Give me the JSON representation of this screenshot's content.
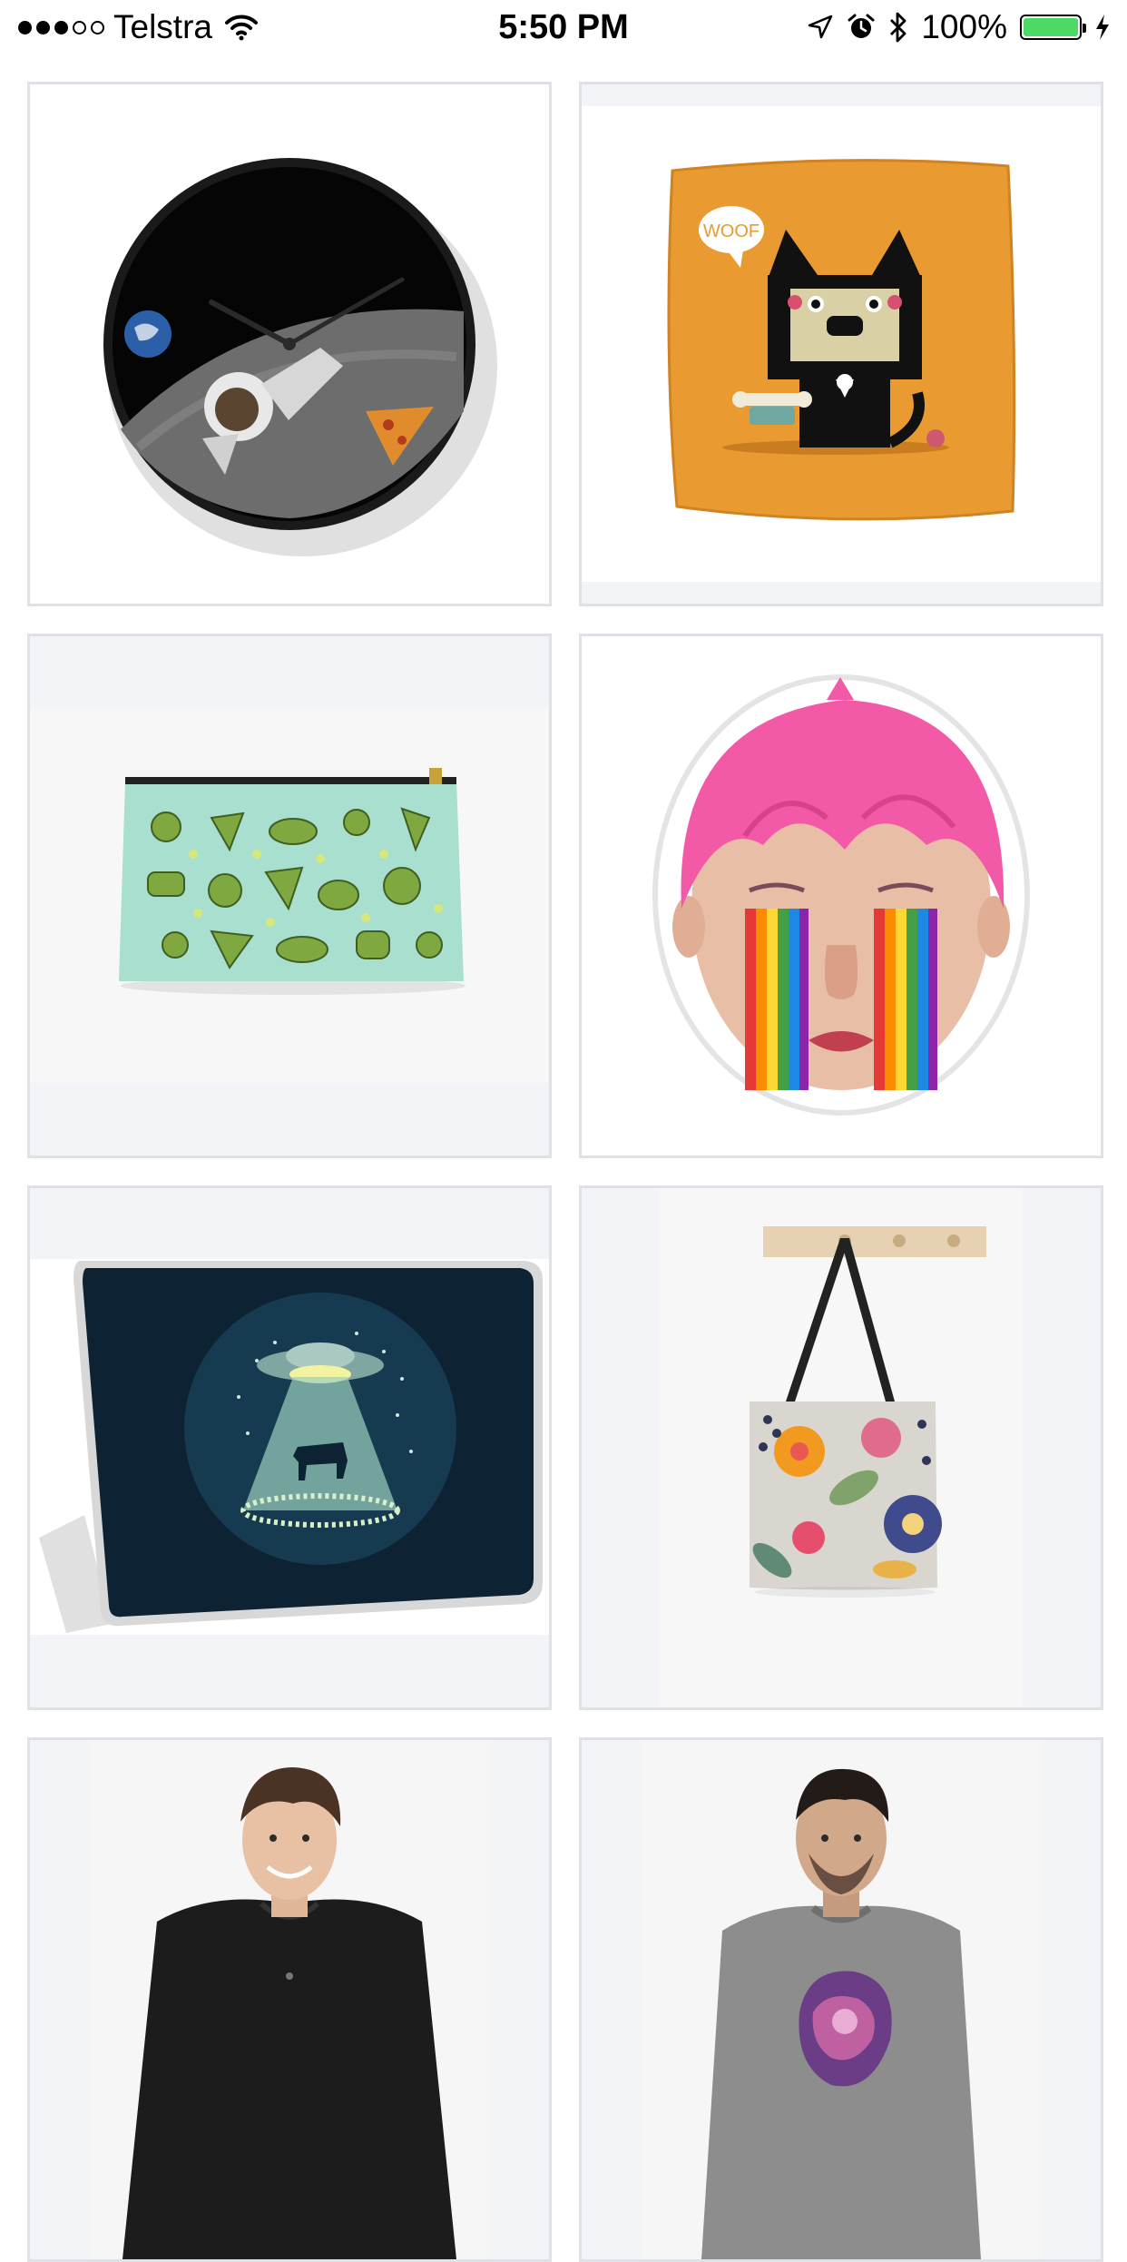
{
  "status_bar": {
    "signal_bars_filled": 3,
    "signal_bars_total": 5,
    "carrier": "Telstra",
    "time": "5:50 PM",
    "battery_percent": "100%",
    "battery_level": 1.0,
    "icons": [
      "wifi-icon",
      "location-arrow-icon",
      "alarm-icon",
      "bluetooth-icon",
      "battery-icon",
      "charging-bolt-icon"
    ]
  },
  "products": [
    {
      "id": "clock",
      "product_type": "wall-clock",
      "speech_text": ""
    },
    {
      "id": "pillow",
      "product_type": "throw-pillow",
      "speech_text": "WOOF"
    },
    {
      "id": "pouch",
      "product_type": "zipper-pouch",
      "speech_text": ""
    },
    {
      "id": "sticker",
      "product_type": "sticker",
      "speech_text": ""
    },
    {
      "id": "laptop-skin",
      "product_type": "laptop-skin",
      "speech_text": ""
    },
    {
      "id": "tote",
      "product_type": "tote-bag",
      "speech_text": ""
    },
    {
      "id": "tshirt-black",
      "product_type": "t-shirt",
      "speech_text": ""
    },
    {
      "id": "sweatshirt-grey",
      "product_type": "sweatshirt",
      "speech_text": ""
    }
  ],
  "colors": {
    "card_border": "#dfe1e8",
    "card_bg": "#f3f4f8",
    "battery_green": "#4cd964",
    "pillow_orange": "#ec9a2e",
    "laptop_navy": "#0d2233",
    "hair_pink": "#f25aa8"
  }
}
